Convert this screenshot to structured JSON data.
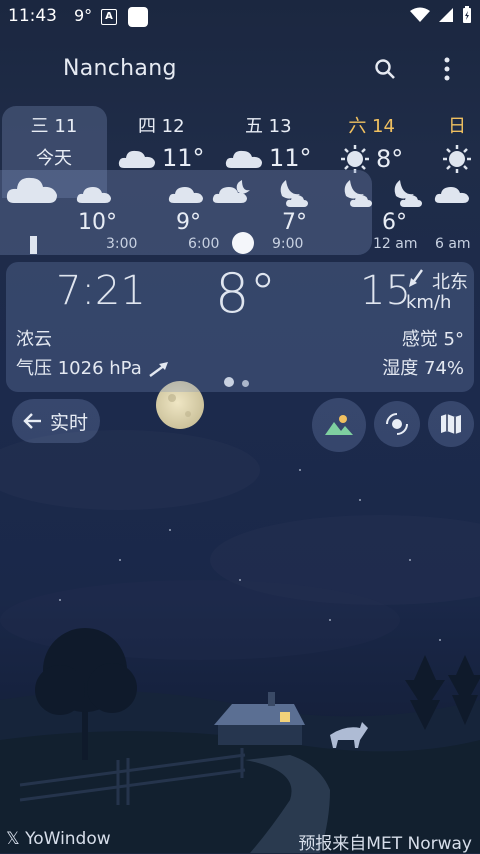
{
  "status_bar": {
    "time": "11:43",
    "temp": "9°",
    "badge": "A"
  },
  "header": {
    "city": "Nanchang",
    "search_icon": "search-icon",
    "menu_icon": "more-vert-icon"
  },
  "days": [
    {
      "name": "三 11",
      "temp": "今天"
    },
    {
      "name": "四 12",
      "temp": "11°"
    },
    {
      "name": "五 13",
      "temp": "11°"
    },
    {
      "name": "六 14",
      "temp": "8°"
    },
    {
      "name": "日",
      "temp": ""
    }
  ],
  "hourly": {
    "temps": [
      "10°",
      "9°",
      "7°",
      "6°"
    ],
    "times": [
      "3:00",
      "6:00",
      "9:00",
      "12 am",
      "6 am"
    ]
  },
  "current": {
    "time": "7:21",
    "temp": "8°",
    "wind_speed": "15",
    "wind_unit": "km/h",
    "wind_dir": "北东",
    "condition": "浓云",
    "feels_like": "感觉 5°",
    "pressure": "气压 1026 hPa",
    "humidity": "湿度 74%"
  },
  "actions": {
    "live_label": "实时"
  },
  "footer": {
    "brand": "𝕏 YoWindow",
    "source": "预报来自MET Norway"
  },
  "colors": {
    "saturday": "#f0c060",
    "panel": "rgba(120,140,185,0.3)"
  }
}
